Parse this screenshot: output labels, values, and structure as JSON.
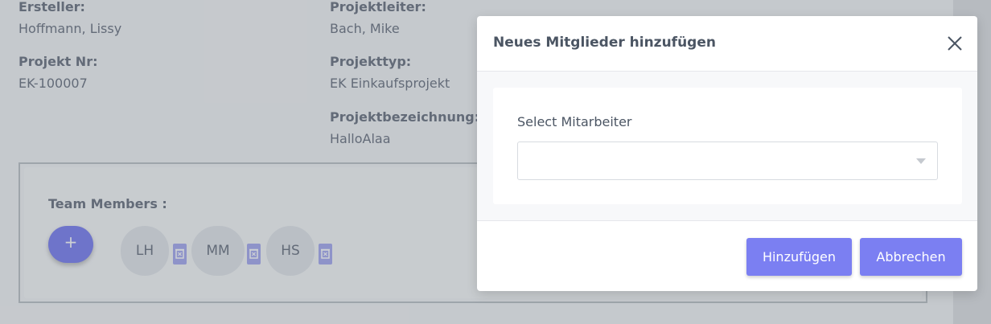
{
  "project_info": {
    "ersteller": {
      "label": "Ersteller:",
      "value": "Hoffmann, Lissy"
    },
    "projektleiter": {
      "label": "Projektleiter:",
      "value": "Bach, Mike"
    },
    "projekt_nr": {
      "label": "Projekt Nr:",
      "value": "EK-100007"
    },
    "projekttyp": {
      "label": "Projekttyp:",
      "value": "EK Einkaufsprojekt"
    },
    "projektbezeichnung": {
      "label": "Projektbezeichnung:",
      "value": "HalloAlaa"
    }
  },
  "team": {
    "title": "Team Members :",
    "add_label": "+",
    "members": [
      {
        "initials": "LH"
      },
      {
        "initials": "MM"
      },
      {
        "initials": "HS"
      }
    ]
  },
  "modal": {
    "title": "Neues Mitglieder hinzufügen",
    "select_label": "Select Mitarbeiter",
    "select_value": "",
    "add_button": "Hinzufügen",
    "cancel_button": "Abbrechen"
  },
  "colors": {
    "accent": "#7b7ff2",
    "backdrop": "rgba(80, 90, 100, 0.28)"
  }
}
